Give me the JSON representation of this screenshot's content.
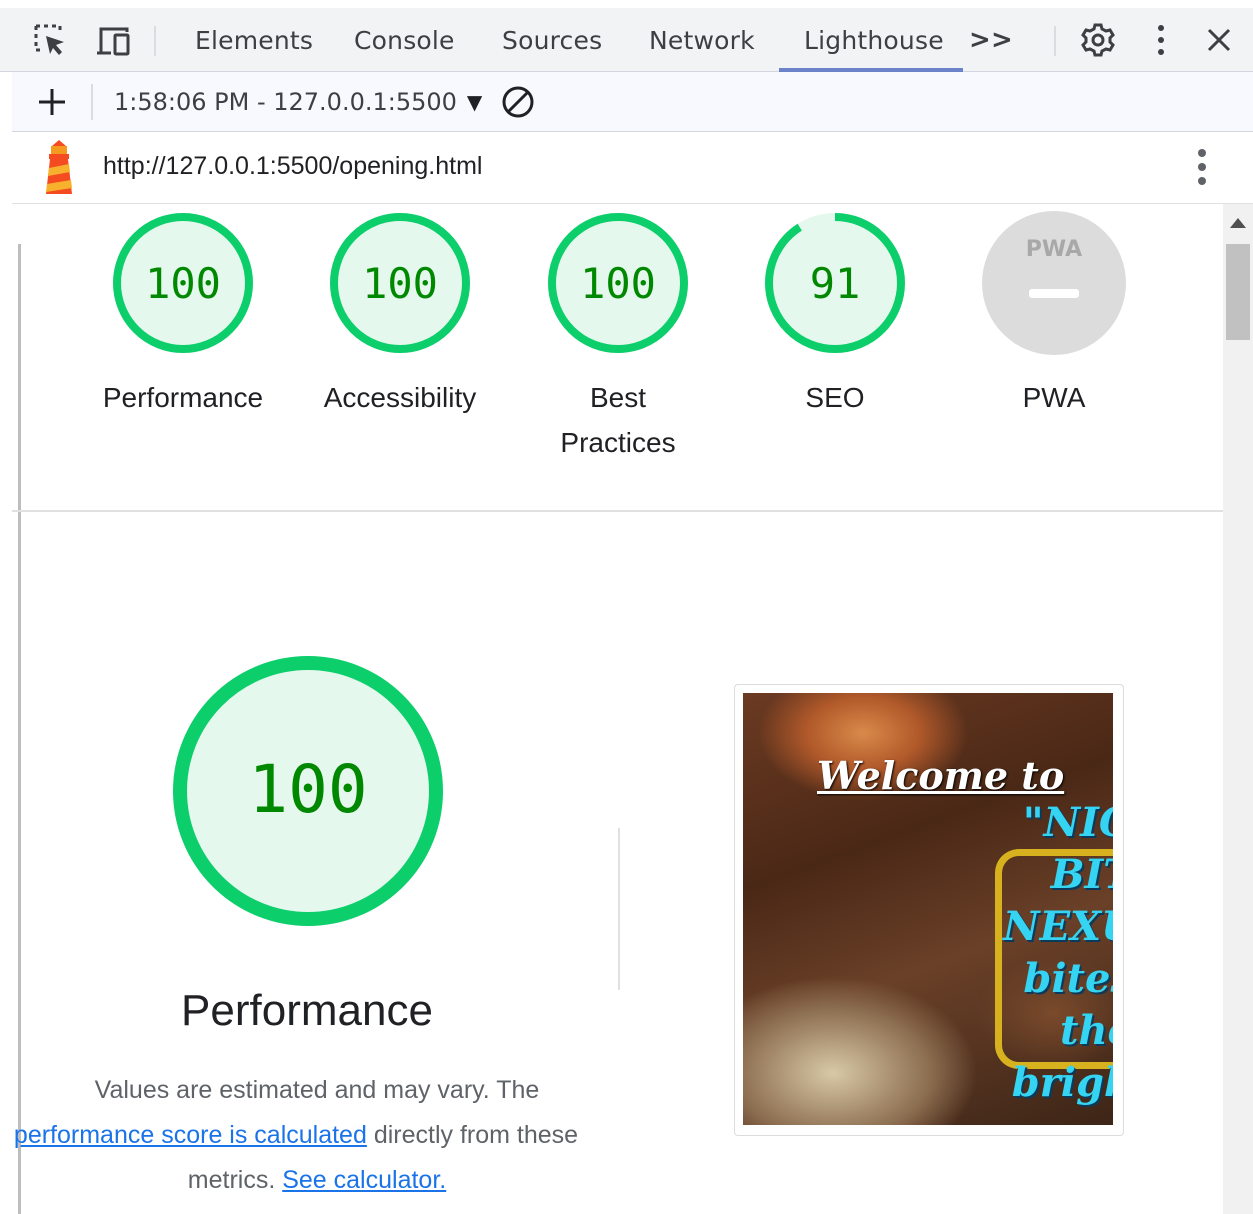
{
  "toolbar": {
    "tabs": [
      {
        "label": "Elements",
        "active": false
      },
      {
        "label": "Console",
        "active": false
      },
      {
        "label": "Sources",
        "active": false
      },
      {
        "label": "Network",
        "active": false
      },
      {
        "label": "Lighthouse",
        "active": true
      }
    ],
    "more_tabs": ">>"
  },
  "report_bar": {
    "new_report": "+",
    "report_selector": "1:58:06 PM - 127.0.0.1:5500",
    "caret": "▼"
  },
  "url_bar": {
    "url": "http://127.0.0.1:5500/opening.html"
  },
  "scores": [
    {
      "category": "Performance",
      "label_lines": [
        "Performance"
      ],
      "score": "100",
      "value": 100,
      "color": "#0cce6b"
    },
    {
      "category": "Accessibility",
      "label_lines": [
        "Accessibility"
      ],
      "score": "100",
      "value": 100,
      "color": "#0cce6b"
    },
    {
      "category": "Best Practices",
      "label_lines": [
        "Best",
        "Practices"
      ],
      "score": "100",
      "value": 100,
      "color": "#0cce6b"
    },
    {
      "category": "SEO",
      "label_lines": [
        "SEO"
      ],
      "score": "91",
      "value": 91,
      "color": "#0cce6b"
    },
    {
      "category": "PWA",
      "label_lines": [
        "PWA"
      ],
      "badge": "PWA",
      "score": "",
      "value": null,
      "color": "#dcdcdc"
    }
  ],
  "performance": {
    "score": "100",
    "value": 100,
    "title": "Performance",
    "desc_part1": "Values are estimated and may vary. The",
    "desc_link1": "performance score is calculated",
    "desc_part2": "directly from these",
    "desc_part3": "metrics.",
    "desc_link2": "See calculator."
  },
  "thumbnail": {
    "welcome": "Welcome to",
    "lines": [
      "\"NIG",
      "BIT",
      "NEXU",
      "bites",
      "the",
      "brigh"
    ]
  },
  "colors": {
    "pass": "#0cce6b",
    "pass_fill": "#e5f8ed",
    "pass_text": "#008800",
    "link": "#1a73e8",
    "neutral": "#dcdcdc"
  }
}
